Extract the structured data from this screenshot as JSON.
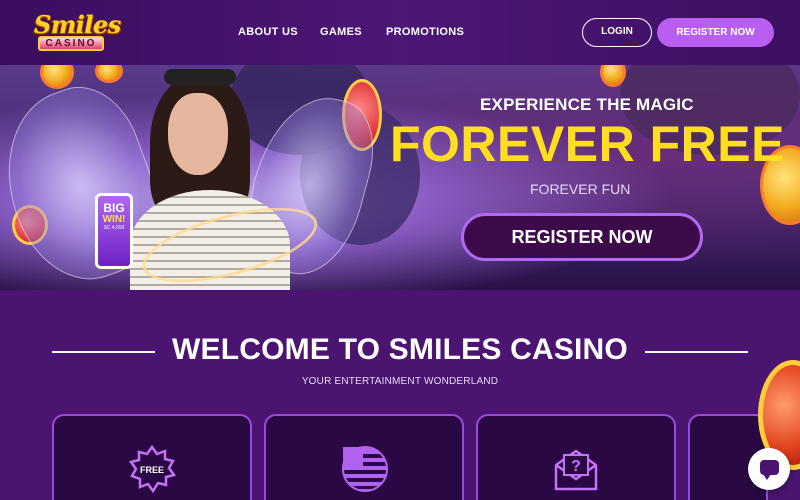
{
  "header": {
    "logo_word": "Smiles",
    "logo_plate": "CASINO",
    "nav": [
      {
        "label": "ABOUT US"
      },
      {
        "label": "GAMES"
      },
      {
        "label": "PROMOTIONS"
      }
    ],
    "login_label": "LOGIN",
    "register_label": "REGISTER NOW"
  },
  "hero": {
    "subtitle": "EXPERIENCE THE MAGIC",
    "title": "FOREVER FREE",
    "tagline": "FOREVER FUN",
    "cta_label": "REGISTER NOW",
    "phone": {
      "big": "BIG",
      "win": "WIN!",
      "amount": "SC 4,693"
    }
  },
  "welcome": {
    "title": "WELCOME TO SMILES CASINO",
    "subtitle": "YOUR ENTERTAINMENT WONDERLAND"
  },
  "cards": [
    {
      "icon": "free-badge-icon",
      "badge_text": "FREE"
    },
    {
      "icon": "us-flag-icon"
    },
    {
      "icon": "mail-question-icon"
    },
    {
      "icon": "partial-card"
    }
  ],
  "colors": {
    "brand_purple": "#4a1470",
    "accent_yellow": "#ffdd1f",
    "button_purple": "#b85ef0",
    "card_border": "#9a4bdc"
  }
}
